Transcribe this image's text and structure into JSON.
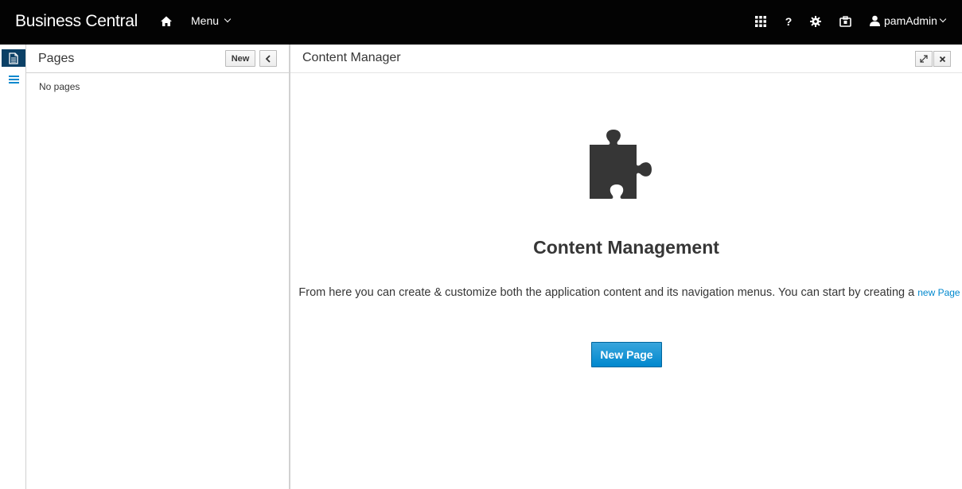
{
  "topbar": {
    "brand": "Business Central",
    "menu_label": "Menu",
    "user_label": "pamAdmin",
    "bg_color": "#030303"
  },
  "rail": {
    "items": [
      {
        "icon": "page-icon",
        "active": true
      },
      {
        "icon": "list-icon",
        "active": false
      }
    ],
    "accent": "#0b4066"
  },
  "pages_panel": {
    "title": "Pages",
    "new_label": "New",
    "empty_text": "No pages"
  },
  "content_panel": {
    "title": "Content Manager",
    "heading": "Content Management",
    "description": "From here you can create & customize both the application content and its navigation menus. You can start by creating a",
    "link_text": "new Page",
    "button_label": "New Page",
    "accent": "#0088ce"
  }
}
